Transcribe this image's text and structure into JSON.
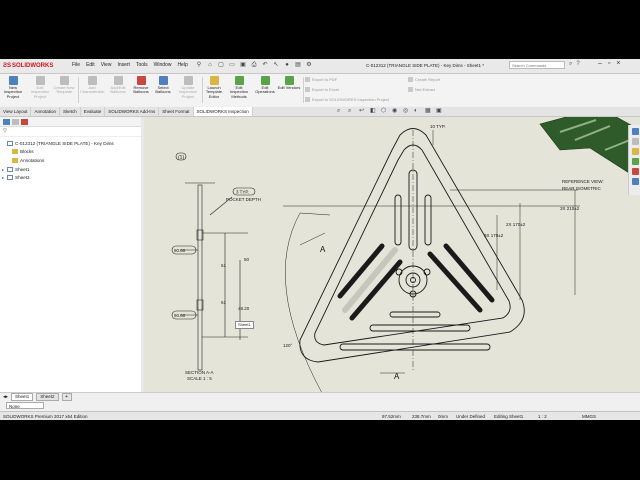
{
  "app": {
    "brand": "SOLIDWORKS",
    "document_title": "C-012312 (TRIANGLE SIDE PLATE) - Key Dims - Sheet1 *",
    "search_placeholder": "Search Commands"
  },
  "menu": [
    "File",
    "Edit",
    "View",
    "Insert",
    "Tools",
    "Window",
    "Help"
  ],
  "ribbon": {
    "buttons": [
      {
        "label": "New Inspection Project",
        "enabled": true,
        "icon": "new-inspection-icon"
      },
      {
        "label": "Edit Inspection Project",
        "enabled": false,
        "icon": "edit-project-icon"
      },
      {
        "label": "Create New Template",
        "enabled": false,
        "icon": "new-template-icon"
      },
      {
        "label": "Add Characteristic",
        "enabled": false,
        "icon": "add-characteristic-icon"
      },
      {
        "label": "Add/Edit Balloons",
        "enabled": false,
        "icon": "add-balloons-icon"
      },
      {
        "label": "Remove Balloons",
        "enabled": true,
        "icon": "remove-balloons-icon"
      },
      {
        "label": "Select Balloons",
        "enabled": true,
        "icon": "select-balloons-icon"
      },
      {
        "label": "Update Inspection Project",
        "enabled": false,
        "icon": "update-project-icon"
      },
      {
        "label": "Launch Template Editor",
        "enabled": true,
        "icon": "template-editor-icon"
      },
      {
        "label": "Edit Inspection Methods",
        "enabled": true,
        "icon": "inspection-methods-icon"
      },
      {
        "label": "Edit Operations",
        "enabled": true,
        "icon": "operations-icon"
      },
      {
        "label": "Edit Vendors",
        "enabled": true,
        "icon": "vendors-icon"
      }
    ],
    "small_buttons": [
      "Export to PDF",
      "Export to Excel",
      "Export to SOLIDWORKS Inspection Project"
    ],
    "small_buttons_right": [
      "Create Report",
      "Net-Extract"
    ]
  },
  "tabs": [
    "View Layout",
    "Annotation",
    "Sketch",
    "Evaluate",
    "SOLIDWORKS Add-Ins",
    "Sheet Format",
    "SOLIDWORKS Inspection"
  ],
  "active_tab": "SOLIDWORKS Inspection",
  "feature_tree": {
    "root": "C-012312 (TRIANGLE SIDE PLATE) - Key Dims",
    "items": [
      "Blocks",
      "Annotations",
      "Sheet1",
      "Sheet2"
    ]
  },
  "drawing": {
    "labels": {
      "typ_ref": "(1)",
      "three_typ": "3 TYP.",
      "pocket_depth": "POCKET DEPTH",
      "ten_typ": "10 TYP.",
      "dim_3x_210": "3X 210±2",
      "dim_2x_170": "2X 170±2",
      "dim_3x_170": "3X 170±2",
      "ref_view_1": "REFERENCE VIEW:",
      "ref_view_2": "REAR ISOMETRIC",
      "section_1": "SECTION A-A",
      "section_2": "SCALE 1 : 5",
      "angle_120": "120°",
      "dim_90_top": "90.60",
      "dim_90_bot": "90.60",
      "dim_61_a": "61",
      "dim_61_b": "61",
      "dim_48": "48.20",
      "dim_50": "50",
      "arrow_a_top": "A",
      "arrow_a_bot": "A"
    },
    "tooltip": "Sheet1"
  },
  "sheets": [
    "Sheet1",
    "Sheet2"
  ],
  "name_field": "None",
  "status": {
    "edition": "SOLIDWORKS Premium 2017 x64 Edition",
    "x": "97.52mm",
    "y": "238.7mm",
    "z": "0mm",
    "state": "Under Defined",
    "editing": "Editing Sheet1",
    "scale": "1 : 2",
    "units": "MMGS"
  }
}
